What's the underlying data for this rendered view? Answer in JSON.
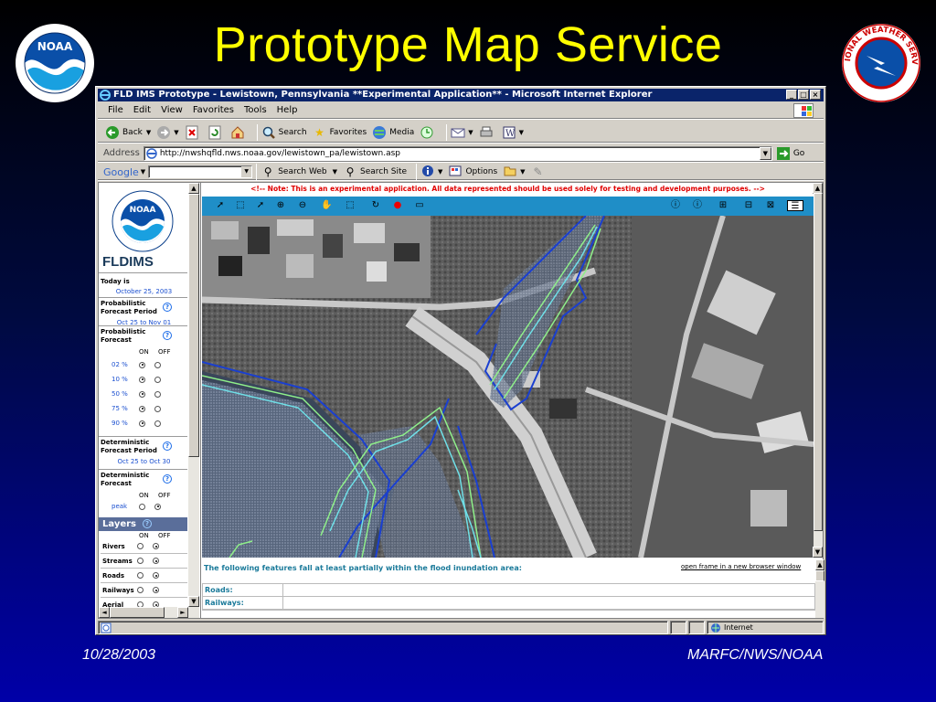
{
  "slide": {
    "title": "Prototype Map Service",
    "footer_left": "10/28/2003",
    "footer_right": "MARFC/NWS/NOAA",
    "noaa_logo_text": "NOAA",
    "nws_logo_text": "NATIONAL WEATHER SERVICE"
  },
  "browser": {
    "title": "FLD IMS Prototype - Lewistown, Pennsylvania **Experimental Application** - Microsoft Internet Explorer",
    "menu": [
      "File",
      "Edit",
      "View",
      "Favorites",
      "Tools",
      "Help"
    ],
    "toolbar": {
      "back": "Back",
      "search": "Search",
      "favorites": "Favorites",
      "media": "Media"
    },
    "address_label": "Address",
    "address_value": "http://nwshqfld.nws.noaa.gov/lewistown_pa/lewistown.asp",
    "go_label": "Go",
    "google": {
      "label": "Google",
      "search_web": "Search Web",
      "search_site": "Search Site",
      "options": "Options"
    },
    "status_zone": "Internet"
  },
  "left_panel": {
    "app_name": "FLDIMS",
    "today_label": "Today is",
    "today_value": "October 25, 2003",
    "prob_period_label": "Probabilistic Forecast Period",
    "prob_period_value": "Oct 25 to Nov 01",
    "prob_forecast_label": "Probabilistic Forecast",
    "on_label": "ON",
    "off_label": "OFF",
    "prob_options": [
      {
        "label": "02 %",
        "on": true
      },
      {
        "label": "10 %",
        "on": true
      },
      {
        "label": "50 %",
        "on": true
      },
      {
        "label": "75 %",
        "on": true
      },
      {
        "label": "90 %",
        "on": true
      }
    ],
    "det_period_label": "Deterministic Forecast Period",
    "det_period_value": "Oct 25 to Oct 30",
    "det_forecast_label": "Deterministic Forecast",
    "det_options": [
      {
        "label": "peak",
        "on": false
      }
    ],
    "layers_label": "Layers",
    "layers": [
      {
        "label": "Rivers",
        "on": false
      },
      {
        "label": "Streams",
        "on": false
      },
      {
        "label": "Roads",
        "on": false
      },
      {
        "label": "Railways",
        "on": false
      },
      {
        "label": "Aerial",
        "on": false
      }
    ]
  },
  "map": {
    "note": "<!-- Note: This is an experimental application. All data represented should be used solely for testing and development purposes. -->"
  },
  "features": {
    "heading": "The following features fall at least partially within the flood inundation area:",
    "open_link": "open frame in a new browser window",
    "rows": [
      "Roads:",
      "Railways:"
    ]
  },
  "colors": {
    "title_yellow": "#ffff00",
    "map_toolbar": "#1f8ec7",
    "note_red": "#e00000",
    "flood_blue": "#1a3fd0",
    "flood_green": "#8ff08a",
    "flood_cyan": "#6fe0e8"
  }
}
